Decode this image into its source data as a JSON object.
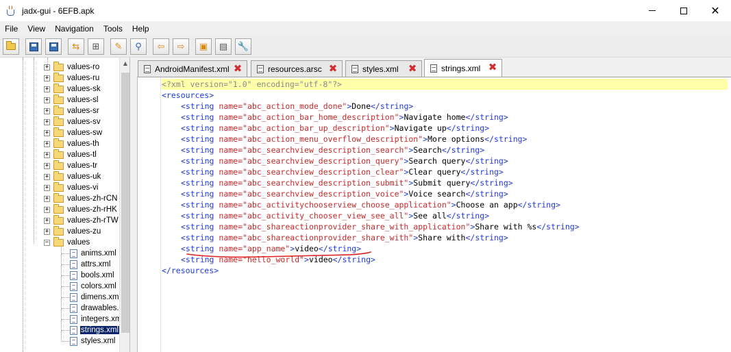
{
  "window": {
    "title": "jadx-gui - 6EFB.apk",
    "minimize_glyph": "",
    "close_glyph": "✕"
  },
  "menu": [
    "File",
    "View",
    "Navigation",
    "Tools",
    "Help"
  ],
  "toolbar": {
    "icons": [
      "open-folder-icon",
      "save-all-icon",
      "save-icon",
      "sync-icon",
      "flatten-packages-icon",
      "search-icon",
      "find-text-icon",
      "back-icon",
      "forward-icon",
      "decompile-all-icon",
      "log-icon",
      "settings-icon"
    ]
  },
  "tree": {
    "items": [
      {
        "label": "values-ro",
        "type": "folder"
      },
      {
        "label": "values-ru",
        "type": "folder"
      },
      {
        "label": "values-sk",
        "type": "folder"
      },
      {
        "label": "values-sl",
        "type": "folder"
      },
      {
        "label": "values-sr",
        "type": "folder"
      },
      {
        "label": "values-sv",
        "type": "folder"
      },
      {
        "label": "values-sw",
        "type": "folder"
      },
      {
        "label": "values-th",
        "type": "folder"
      },
      {
        "label": "values-tl",
        "type": "folder"
      },
      {
        "label": "values-tr",
        "type": "folder"
      },
      {
        "label": "values-uk",
        "type": "folder"
      },
      {
        "label": "values-vi",
        "type": "folder"
      },
      {
        "label": "values-zh-rCN",
        "type": "folder"
      },
      {
        "label": "values-zh-rHK",
        "type": "folder"
      },
      {
        "label": "values-zh-rTW",
        "type": "folder"
      },
      {
        "label": "values-zu",
        "type": "folder"
      },
      {
        "label": "values",
        "type": "folder-open"
      },
      {
        "label": "anims.xml",
        "type": "file"
      },
      {
        "label": "attrs.xml",
        "type": "file"
      },
      {
        "label": "bools.xml",
        "type": "file"
      },
      {
        "label": "colors.xml",
        "type": "file"
      },
      {
        "label": "dimens.xml",
        "type": "file"
      },
      {
        "label": "drawables.x",
        "type": "file"
      },
      {
        "label": "integers.xm",
        "type": "file"
      },
      {
        "label": "strings.xml",
        "type": "file",
        "selected": true
      },
      {
        "label": "styles.xml",
        "type": "file"
      }
    ],
    "expand_glyph": "+",
    "collapse_glyph": "−"
  },
  "tabs": [
    {
      "label": "AndroidManifest.xml",
      "close": "✖"
    },
    {
      "label": "resources.arsc",
      "close": "✖"
    },
    {
      "label": "styles.xml",
      "close": "✖"
    },
    {
      "label": "strings.xml",
      "close": "✖",
      "active": true
    }
  ],
  "editor": {
    "decl": "<?xml version=\"1.0\" encoding=\"utf-8\"?>",
    "open_root": "<resources>",
    "close_root": "</resources>",
    "tag_open": "<string",
    "tag_close": "</string>",
    "attr_name": "name=",
    "strings": [
      {
        "name": "\"abc_action_mode_done\"",
        "text": "Done"
      },
      {
        "name": "\"abc_action_bar_home_description\"",
        "text": "Navigate home"
      },
      {
        "name": "\"abc_action_bar_up_description\"",
        "text": "Navigate up"
      },
      {
        "name": "\"abc_action_menu_overflow_description\"",
        "text": "More options"
      },
      {
        "name": "\"abc_searchview_description_search\"",
        "text": "Search"
      },
      {
        "name": "\"abc_searchview_description_query\"",
        "text": "Search query"
      },
      {
        "name": "\"abc_searchview_description_clear\"",
        "text": "Clear query"
      },
      {
        "name": "\"abc_searchview_description_submit\"",
        "text": "Submit query"
      },
      {
        "name": "\"abc_searchview_description_voice\"",
        "text": "Voice search"
      },
      {
        "name": "\"abc_activitychooserview_choose_application\"",
        "text": "Choose an app"
      },
      {
        "name": "\"abc_activity_chooser_view_see_all\"",
        "text": "See all"
      },
      {
        "name": "\"abc_shareactionprovider_share_with_application\"",
        "text": "Share with %s"
      },
      {
        "name": "\"abc_shareactionprovider_share_with\"",
        "text": "Share with"
      },
      {
        "name": "\"app_name\"",
        "text": "video"
      },
      {
        "name": "\"hello_world\"",
        "text": "video"
      }
    ]
  },
  "colors": {
    "annotation": "#e0201e",
    "selection": "#0a246a",
    "current_line": "#ffffaa"
  }
}
